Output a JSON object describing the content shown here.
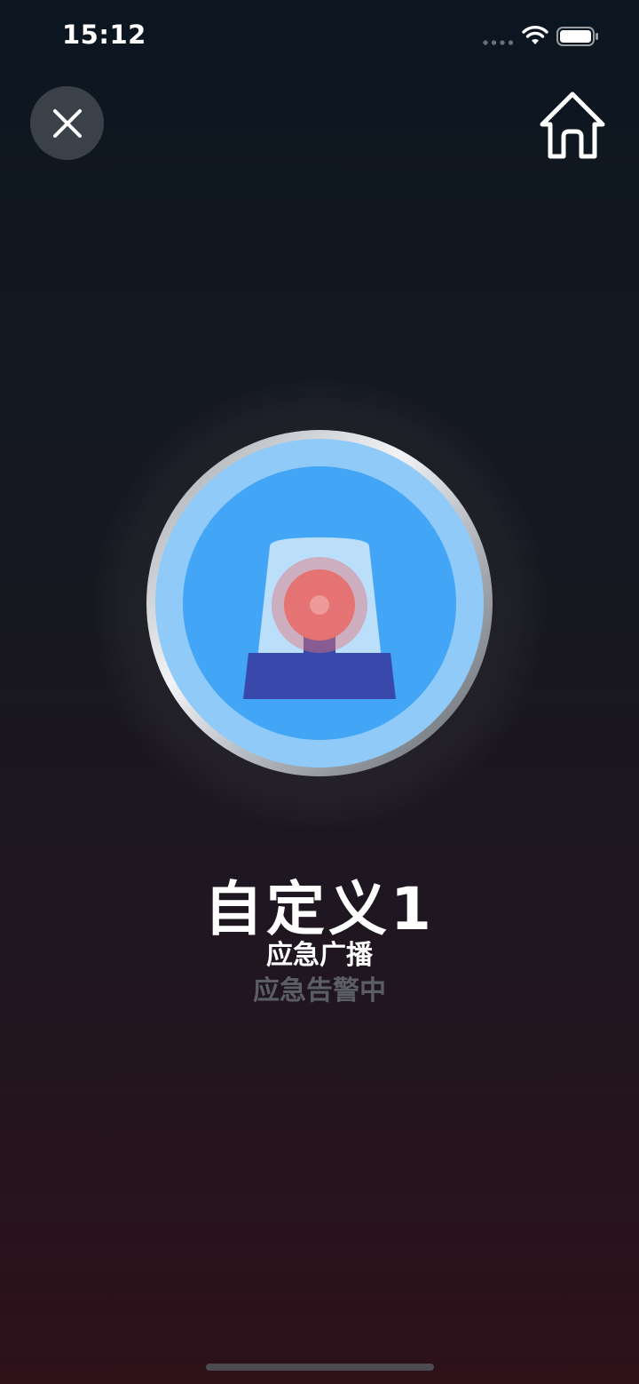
{
  "status_bar": {
    "time": "15:12"
  },
  "icons": {
    "close": "close-icon",
    "home": "home-icon",
    "alarm": "siren-icon",
    "signal": "signal-icon",
    "wifi": "wifi-icon",
    "battery": "battery-icon"
  },
  "alarm": {
    "title": "自定义1",
    "type": "应急广播",
    "status": "应急告警中"
  },
  "colors": {
    "alarm_outer": "#90caf9",
    "alarm_inner": "#42a5f5",
    "siren_base": "#3949ab",
    "siren_light": "#e57373"
  }
}
